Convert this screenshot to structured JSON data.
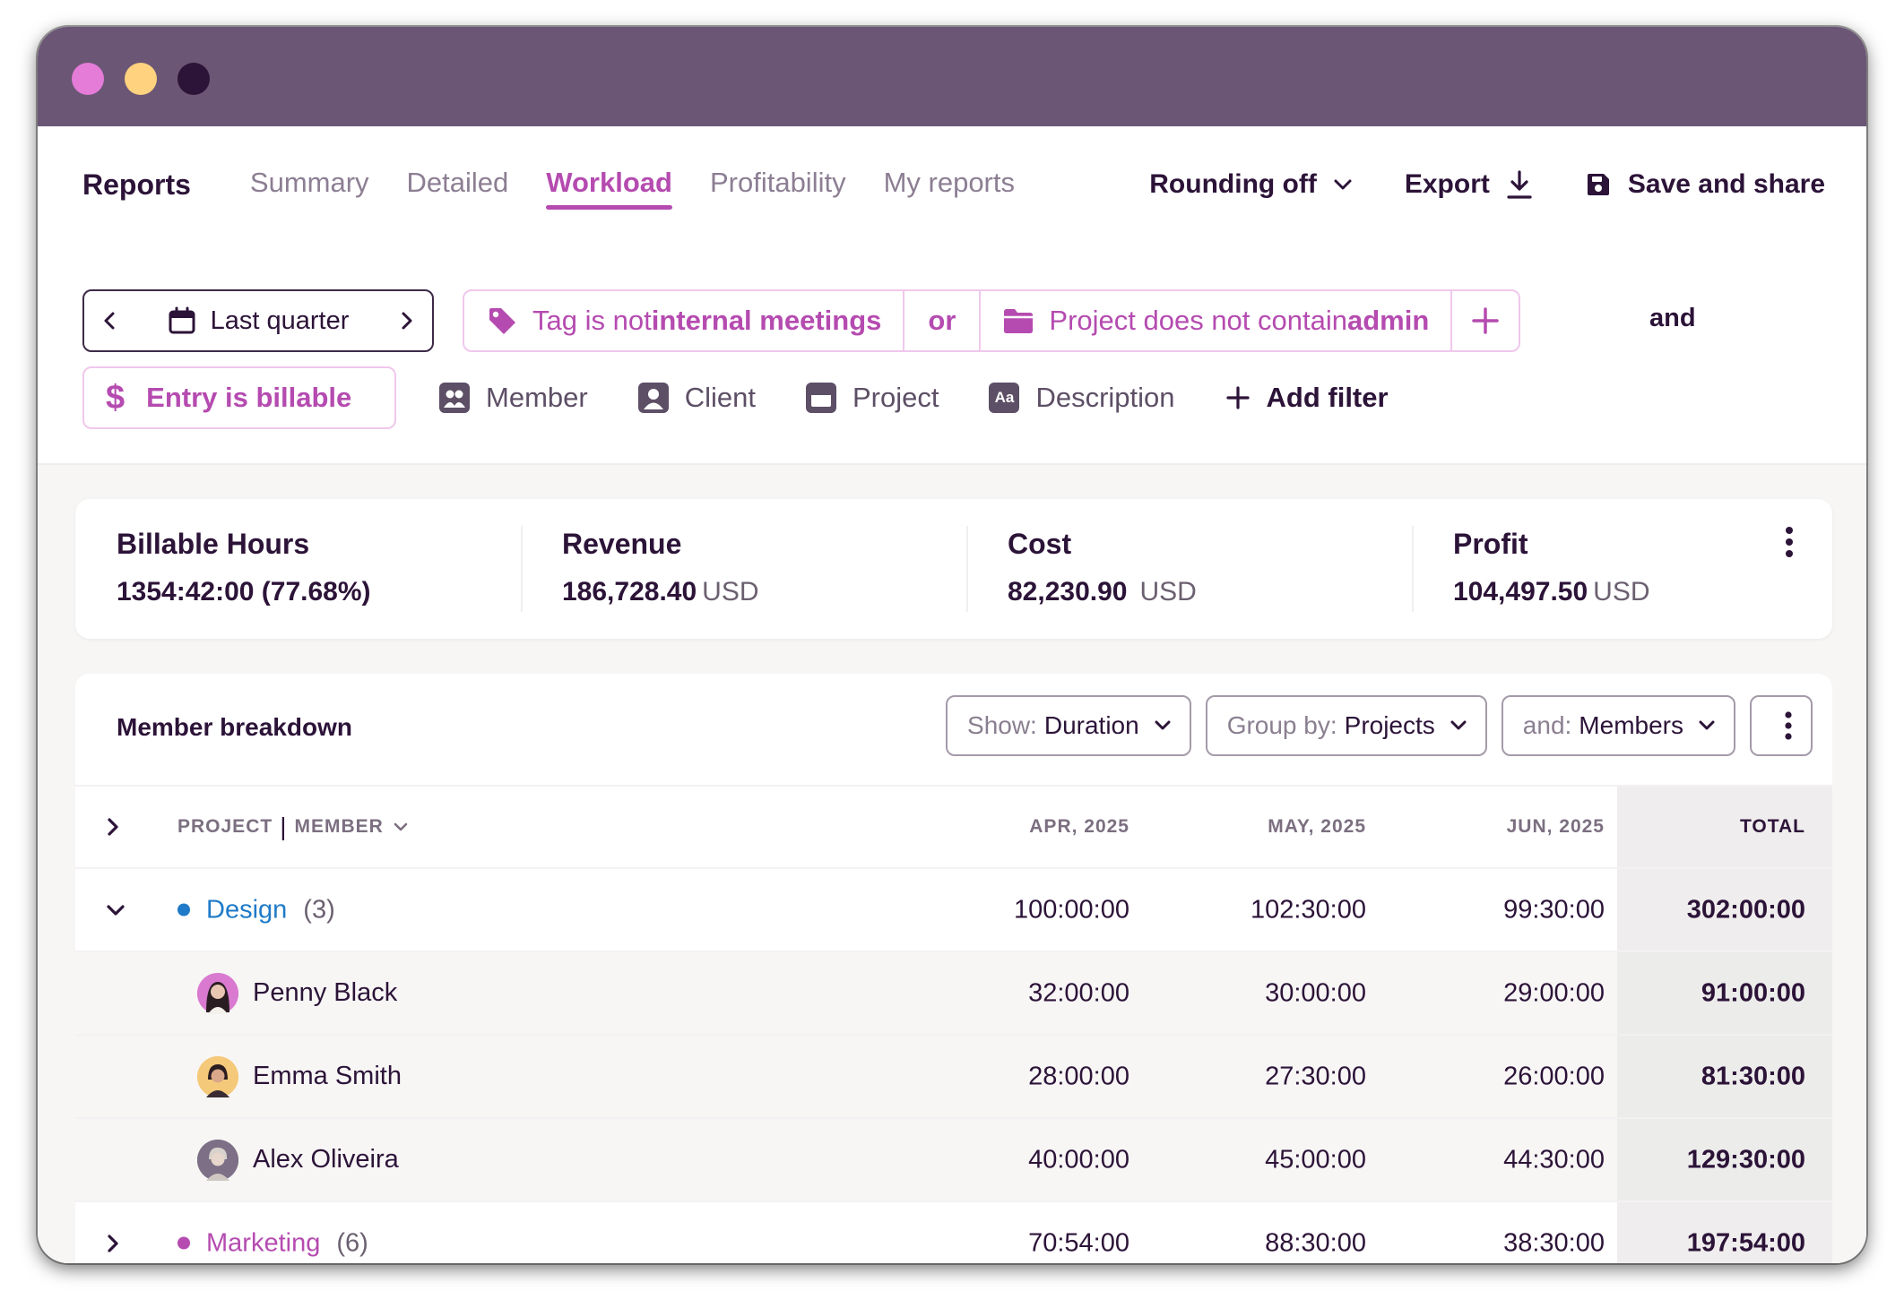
{
  "nav": {
    "title": "Reports",
    "tabs": [
      {
        "label": "Summary"
      },
      {
        "label": "Detailed"
      },
      {
        "label": "Workload"
      },
      {
        "label": "Profitability"
      },
      {
        "label": "My reports"
      }
    ],
    "active_tab": "Workload"
  },
  "actions": {
    "rounding": "Rounding off",
    "export": "Export",
    "save_share": "Save and share"
  },
  "filters": {
    "date_range": "Last quarter",
    "tag_filter": {
      "prefix": "Tag is not ",
      "value": "internal meetings"
    },
    "or_label": "or",
    "project_filter": {
      "prefix": "Project does not contain ",
      "value": "admin"
    },
    "and_label": "and",
    "billable": {
      "symbol": "$",
      "label": "Entry is billable"
    },
    "quick": {
      "member": "Member",
      "member_icon_text": "",
      "client": "Client",
      "project": "Project",
      "description": "Description",
      "description_icon_text": "Aa",
      "add_filter": "Add filter"
    }
  },
  "stats": [
    {
      "label": "Billable Hours",
      "value": "1354:42:00 (77.68%)",
      "currency": ""
    },
    {
      "label": "Revenue",
      "value": "186,728.40",
      "currency": "USD"
    },
    {
      "label": "Cost",
      "value": "82,230.90",
      "currency": "USD"
    },
    {
      "label": "Profit",
      "value": "104,497.50",
      "currency": "USD"
    }
  ],
  "breakdown": {
    "title": "Member breakdown",
    "show": {
      "label": "Show:",
      "value": "Duration"
    },
    "group_by": {
      "label": "Group by:",
      "value": "Projects"
    },
    "and_by": {
      "label": "and:",
      "value": "Members"
    }
  },
  "table": {
    "header": {
      "name_a": "PROJECT",
      "sep": "|",
      "name_b": "MEMBER",
      "col1": "APR, 2025",
      "col2": "MAY, 2025",
      "col3": "JUN, 2025",
      "total": "TOTAL"
    },
    "design": {
      "name": "Design",
      "count": "(3)",
      "color": "#1f7ac8",
      "c1": "100:00:00",
      "c2": "102:30:00",
      "c3": "99:30:00",
      "total": "302:00:00"
    },
    "members": [
      {
        "name": "Penny Black",
        "c1": "32:00:00",
        "c2": "30:00:00",
        "c3": "29:00:00",
        "total": "91:00:00",
        "avatar_color": "#d97ad0"
      },
      {
        "name": "Emma Smith",
        "c1": "28:00:00",
        "c2": "27:30:00",
        "c3": "26:00:00",
        "total": "81:30:00",
        "avatar_color": "#f5c97a"
      },
      {
        "name": "Alex Oliveira",
        "c1": "40:00:00",
        "c2": "45:00:00",
        "c3": "44:30:00",
        "total": "129:30:00",
        "avatar_color": "#7d6f86"
      }
    ],
    "marketing": {
      "name": "Marketing",
      "count": "(6)",
      "color": "#b54bb0",
      "c1": "70:54:00",
      "c2": "88:30:00",
      "c3": "38:30:00",
      "total": "197:54:00"
    }
  }
}
